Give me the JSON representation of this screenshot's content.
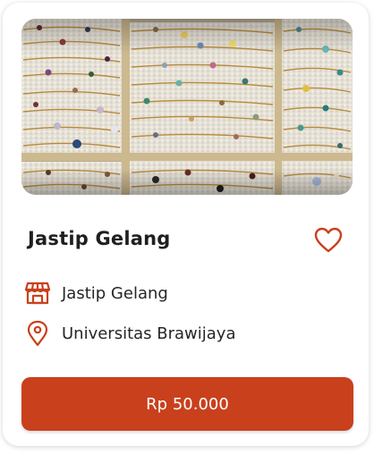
{
  "product": {
    "title": "Jastip Gelang",
    "store_name": "Jastip Gelang",
    "location": "Universitas Brawijaya",
    "price_label": "Rp 50.000"
  },
  "icons": {
    "favorite": "heart-outline-icon",
    "store": "storefront-icon",
    "location": "map-pin-icon"
  },
  "colors": {
    "accent": "#c9401c",
    "text": "#1f1f1f"
  }
}
